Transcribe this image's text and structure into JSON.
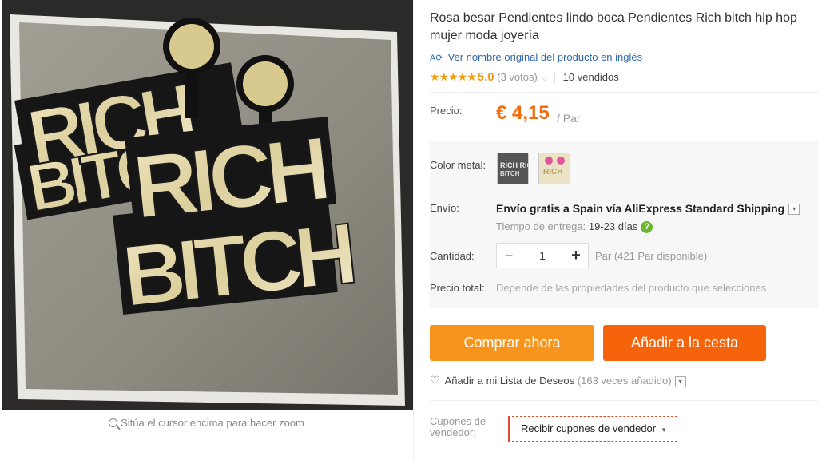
{
  "product": {
    "title_line1": "Rosa besar Pendientes lindo boca Pendientes Rich bitch hip hop",
    "title_line2": "mujer moda joyería",
    "original_name_link": "Ver nombre original del producto en inglés",
    "stars": "★★★★★",
    "rating": "5.0",
    "votes": "(3 votos)",
    "sold": "10 vendidos"
  },
  "image": {
    "zoom_hint": "Sitúa el cursor encima para hacer zoom",
    "earring_text": [
      "RICH",
      "BITCH"
    ]
  },
  "price": {
    "label": "Precio:",
    "value": "€ 4,15",
    "unit": "/ Par"
  },
  "options": {
    "color_label": "Color metal:",
    "swatch_texts": [
      "RICH RICH",
      "RICH"
    ]
  },
  "shipping": {
    "label": "Envío:",
    "text": "Envío gratis a Spain vía AliExpress Standard Shipping",
    "delivery_label": "Tiempo de entrega:",
    "delivery_days": "19-23 días",
    "help_icon": "?"
  },
  "quantity": {
    "label": "Cantidad:",
    "minus": "−",
    "value": "1",
    "plus": "+",
    "available": "Par (421 Par disponible)"
  },
  "total": {
    "label": "Precio total:",
    "note": "Depende de las propiedades del producto que selecciones"
  },
  "actions": {
    "buy_now": "Comprar ahora",
    "add_to_cart": "Añadir a la cesta",
    "wishlist": "Añadir a mi Lista de Deseos",
    "wishlist_count": "(163 veces añadido)"
  },
  "coupons": {
    "label": "Cupones de vendedor:",
    "button": "Recibir cupones de vendedor"
  },
  "colors": {
    "accent_price": "#f56c0d",
    "buy_button": "#f7941d",
    "cart_button": "#f5640b",
    "star": "#f09b12",
    "link": "#2f67a8"
  }
}
